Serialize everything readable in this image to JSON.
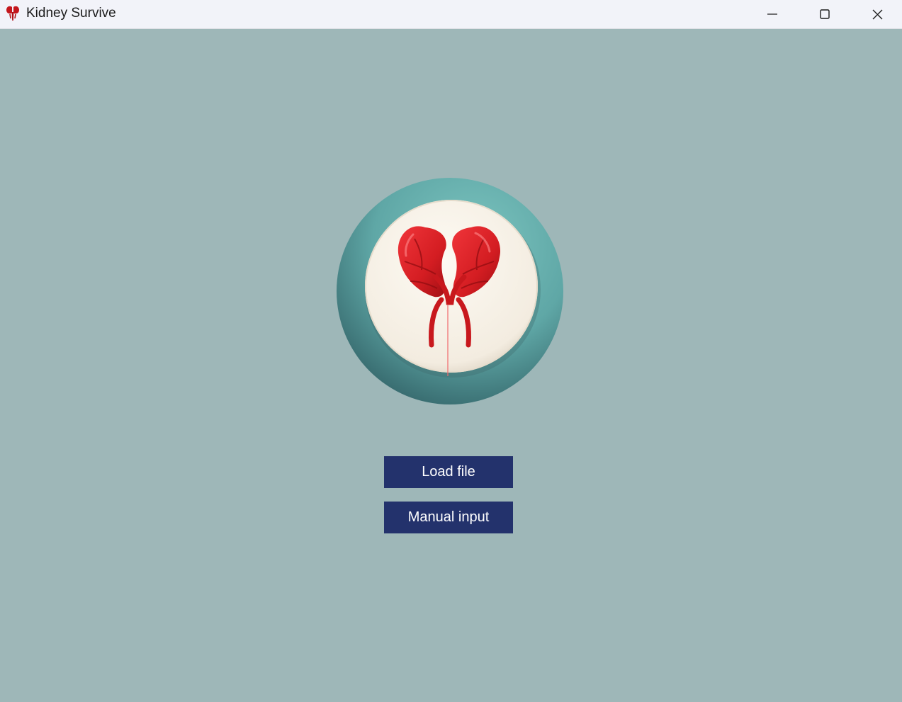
{
  "window": {
    "title": "Kidney Survive",
    "icon": "kidney-app-icon",
    "controls": {
      "minimize_icon": "minimize-icon",
      "maximize_icon": "maximize-icon",
      "close_icon": "close-icon"
    }
  },
  "main": {
    "logo_icon": "kidney-logo-icon",
    "buttons": {
      "load_file": "Load file",
      "manual_input": "Manual input"
    }
  },
  "colors": {
    "background": "#9eb7b8",
    "titlebar": "#f2f3f9",
    "button": "#23326c",
    "button_text": "#ffffff",
    "kidney_red": "#d41d22",
    "logo_ring": "#6fb7b4",
    "logo_plate": "#f6f0e6"
  }
}
